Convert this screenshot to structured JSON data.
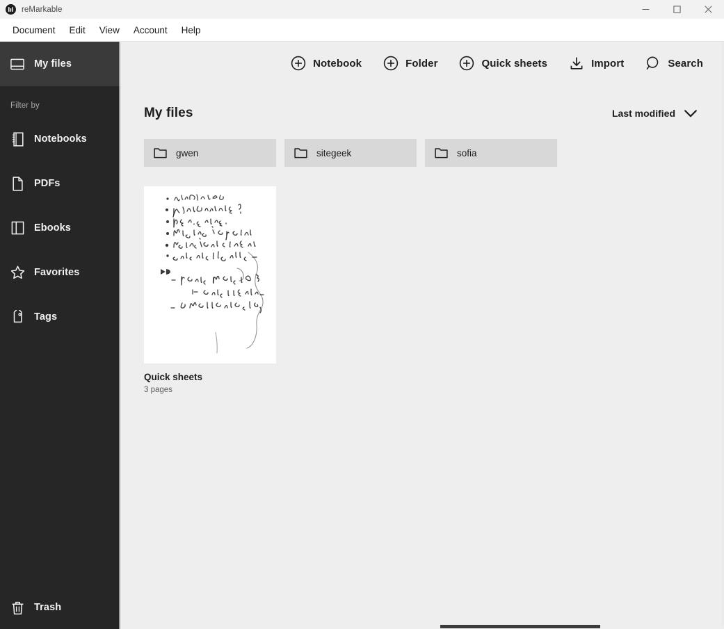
{
  "window": {
    "app_name": "reMarkable",
    "logo_icon": "remarkable-logo-icon",
    "controls": {
      "minimize": "minimize-icon",
      "maximize": "maximize-icon",
      "close": "close-icon"
    }
  },
  "menubar": {
    "items": [
      {
        "label": "Document"
      },
      {
        "label": "Edit"
      },
      {
        "label": "View"
      },
      {
        "label": "Account"
      },
      {
        "label": "Help"
      }
    ]
  },
  "sidebar": {
    "primary": {
      "label": "My files",
      "icon": "my-files-icon",
      "active": true
    },
    "filter_heading": "Filter by",
    "filters": [
      {
        "label": "Notebooks",
        "icon": "notebook-icon"
      },
      {
        "label": "PDFs",
        "icon": "pdf-page-icon"
      },
      {
        "label": "Ebooks",
        "icon": "ebook-icon"
      },
      {
        "label": "Favorites",
        "icon": "star-icon"
      },
      {
        "label": "Tags",
        "icon": "tag-icon"
      }
    ],
    "trash": {
      "label": "Trash",
      "icon": "trash-icon"
    }
  },
  "toolbar": {
    "buttons": [
      {
        "label": "Notebook",
        "icon": "plus-circle-icon"
      },
      {
        "label": "Folder",
        "icon": "plus-circle-icon"
      },
      {
        "label": "Quick sheets",
        "icon": "plus-circle-icon"
      },
      {
        "label": "Import",
        "icon": "import-download-icon"
      },
      {
        "label": "Search",
        "icon": "search-icon"
      }
    ]
  },
  "content": {
    "page_title": "My files",
    "sort": {
      "label": "Last modified",
      "icon": "chevron-down-icon"
    },
    "folders": [
      {
        "name": "gwen",
        "icon": "folder-icon"
      },
      {
        "name": "sitegeek",
        "icon": "folder-icon"
      },
      {
        "name": "sofia",
        "icon": "folder-icon"
      }
    ],
    "documents": [
      {
        "name": "Quick sheets",
        "pages": "3 pages",
        "thumbnail": "handwritten-notes-thumbnail"
      }
    ]
  },
  "colors": {
    "sidebar_bg": "#262626",
    "sidebar_active": "#3a3a3a",
    "main_bg": "#eeeeee",
    "card_bg": "#d8d8d8",
    "titlebar_bg": "#f2f2f2",
    "text_primary": "#1d1d1d"
  }
}
